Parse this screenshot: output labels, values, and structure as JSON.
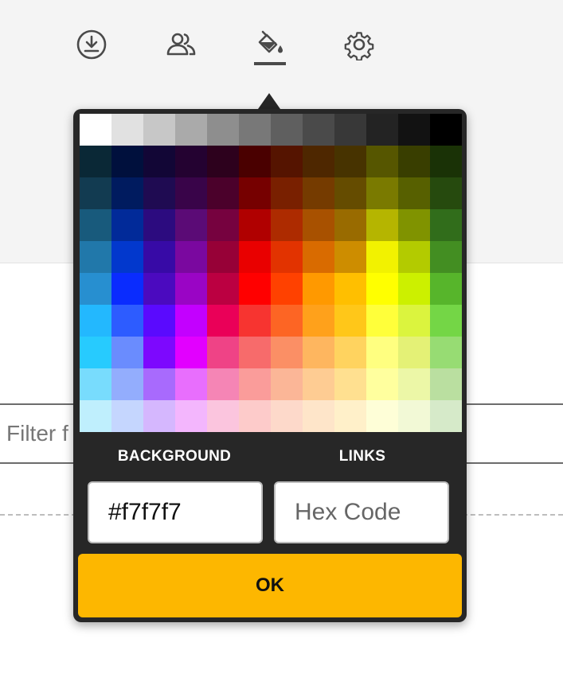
{
  "toolbar": {
    "items": [
      {
        "name": "download",
        "icon": "download-circle-icon"
      },
      {
        "name": "users",
        "icon": "users-icon"
      },
      {
        "name": "paint-bucket",
        "icon": "paint-bucket-icon",
        "active": true
      },
      {
        "name": "settings",
        "icon": "gear-icon"
      }
    ]
  },
  "filter": {
    "placeholder": "Filter f"
  },
  "color_picker": {
    "palette": [
      [
        "#ffffff",
        "#e1e1e1",
        "#c7c7c7",
        "#aaaaaa",
        "#8e8e8e",
        "#787878",
        "#5f5f5f",
        "#4a4a4a",
        "#383838",
        "#232323",
        "#121212",
        "#000000"
      ],
      [
        "#0a2836",
        "#00103d",
        "#120636",
        "#240231",
        "#2d011d",
        "#4a0000",
        "#551400",
        "#4e2700",
        "#473300",
        "#565600",
        "#393e00",
        "#1a3206"
      ],
      [
        "#123b51",
        "#001b5f",
        "#1f0b52",
        "#390449",
        "#4b012b",
        "#760000",
        "#792000",
        "#753b00",
        "#654c00",
        "#7a7a00",
        "#576000",
        "#264a0e"
      ],
      [
        "#185a7c",
        "#012a99",
        "#2c0b7f",
        "#5b0b76",
        "#76023f",
        "#b00000",
        "#ad2b00",
        "#a85100",
        "#996b00",
        "#b5b500",
        "#809300",
        "#316d1b"
      ],
      [
        "#2178aa",
        "#0238cd",
        "#370aa6",
        "#7a089f",
        "#970137",
        "#e90000",
        "#e23300",
        "#d96b00",
        "#cd8d00",
        "#f2f200",
        "#b3cb00",
        "#438e22"
      ],
      [
        "#278fd0",
        "#0a2cfe",
        "#4b0abf",
        "#9a05c5",
        "#bb0041",
        "#ff0000",
        "#ff4100",
        "#ff9900",
        "#ffbf00",
        "#ffff00",
        "#ccf000",
        "#57b52b"
      ],
      [
        "#23b8fe",
        "#2d5cff",
        "#5a0afe",
        "#c300ff",
        "#ea0058",
        "#f73430",
        "#fd6524",
        "#ffa11b",
        "#ffc719",
        "#ffff3a",
        "#dbf43e",
        "#74d646"
      ],
      [
        "#27cbfe",
        "#6a8cfe",
        "#7d08fe",
        "#e200ff",
        "#ef4386",
        "#f76b6b",
        "#fb8f65",
        "#feb65f",
        "#ffd35f",
        "#ffff80",
        "#e4f176",
        "#97dc73"
      ],
      [
        "#78dcfd",
        "#93adfd",
        "#a86afd",
        "#e86efd",
        "#f585b5",
        "#fa9c9a",
        "#fbb697",
        "#fecc93",
        "#ffe090",
        "#ffff9e",
        "#ecf7a7",
        "#badfa0"
      ],
      [
        "#bfeffd",
        "#c5d6fe",
        "#d5b7fe",
        "#f3b6fd",
        "#fbc5de",
        "#fdcbca",
        "#fdd9ca",
        "#fee5c9",
        "#fff0c9",
        "#fefed7",
        "#f2f9d6",
        "#d6eac9"
      ]
    ],
    "background_label": "BACKGROUND",
    "links_label": "LINKS",
    "background_value": "#f7f7f7",
    "links_placeholder": "Hex Code",
    "ok_label": "OK",
    "accent_color": "#fdb700"
  }
}
